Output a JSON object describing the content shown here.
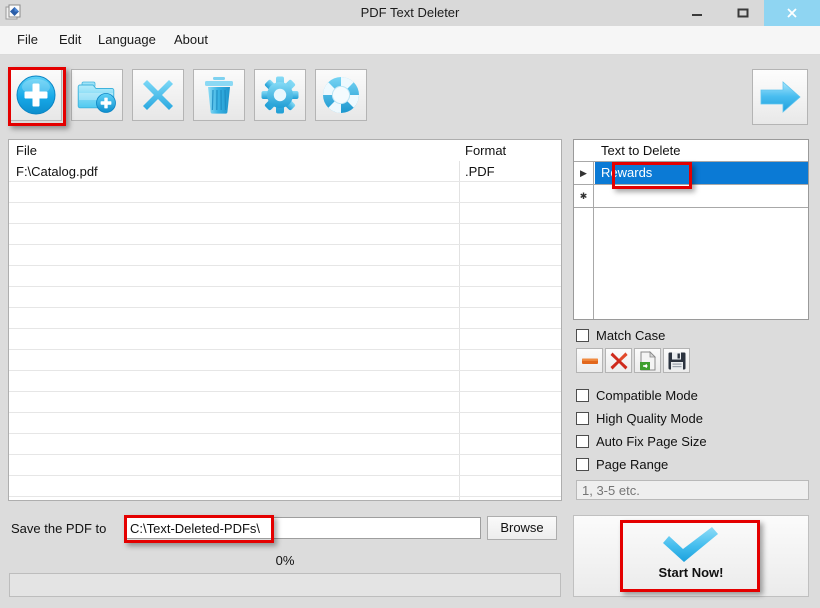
{
  "window": {
    "title": "PDF Text Deleter",
    "app_icon": "app-icon",
    "minimize_label": "–",
    "maximize_label": "□",
    "close_label": "×",
    "close_button_color": "#8fd5f2"
  },
  "menubar": {
    "items": [
      {
        "label": "File"
      },
      {
        "label": "Edit"
      },
      {
        "label": "Language"
      },
      {
        "label": "About"
      }
    ]
  },
  "toolbar": {
    "buttons": [
      {
        "name": "add-file-button",
        "icon": "plus-circle-icon",
        "highlighted": true
      },
      {
        "name": "add-folder-button",
        "icon": "folder-add-icon",
        "highlighted": false
      },
      {
        "name": "remove-file-button",
        "icon": "x-mark-icon",
        "highlighted": false
      },
      {
        "name": "clear-list-button",
        "icon": "trash-icon",
        "highlighted": false
      },
      {
        "name": "settings-button",
        "icon": "gear-icon",
        "highlighted": false
      },
      {
        "name": "help-button",
        "icon": "life-ring-icon",
        "highlighted": false
      }
    ],
    "next_button": {
      "name": "next-arrow-button",
      "icon": "arrow-right-icon"
    }
  },
  "file_list": {
    "columns": [
      "File",
      "Format"
    ],
    "rows": [
      {
        "file": "F:\\Catalog.pdf",
        "format": ".PDF"
      }
    ]
  },
  "text_grid": {
    "header": "Text to Delete",
    "rows": [
      {
        "indicator": "▶",
        "text": "Rewards",
        "selected": true
      },
      {
        "indicator": "✱",
        "text": "",
        "selected": false
      }
    ],
    "selection_color": "#0b7ad5"
  },
  "options": {
    "match_case": {
      "label": "Match Case",
      "checked": false
    },
    "row_buttons": [
      {
        "name": "remove-row-button",
        "icon": "minus-icon"
      },
      {
        "name": "delete-all-rows-button",
        "icon": "red-x-icon"
      },
      {
        "name": "load-list-button",
        "icon": "open-file-icon"
      },
      {
        "name": "save-list-button",
        "icon": "floppy-save-icon"
      }
    ],
    "checkboxes": [
      {
        "label": "Compatible Mode",
        "checked": false
      },
      {
        "label": "High Quality Mode",
        "checked": false
      },
      {
        "label": "Auto Fix Page Size",
        "checked": false
      },
      {
        "label": "Page Range",
        "checked": false
      }
    ],
    "page_range_input": {
      "value": "",
      "placeholder": "1, 3-5 etc.",
      "enabled": false
    }
  },
  "bottom": {
    "save_label": "Save the PDF to",
    "save_path_value": "C:\\Text-Deleted-PDFs\\",
    "save_path_placeholder": "",
    "browse_label": "Browse",
    "progress_percent_label": "0%",
    "progress_value": 0
  },
  "start": {
    "label": "Start Now!",
    "icon": "checkmark-icon"
  },
  "annotations": {
    "accent_color": "#e40000",
    "boxes": [
      {
        "target": "add-file-button"
      },
      {
        "target": "grid-selected-cell"
      },
      {
        "target": "save-path-input"
      },
      {
        "target": "start-now-button"
      }
    ]
  }
}
